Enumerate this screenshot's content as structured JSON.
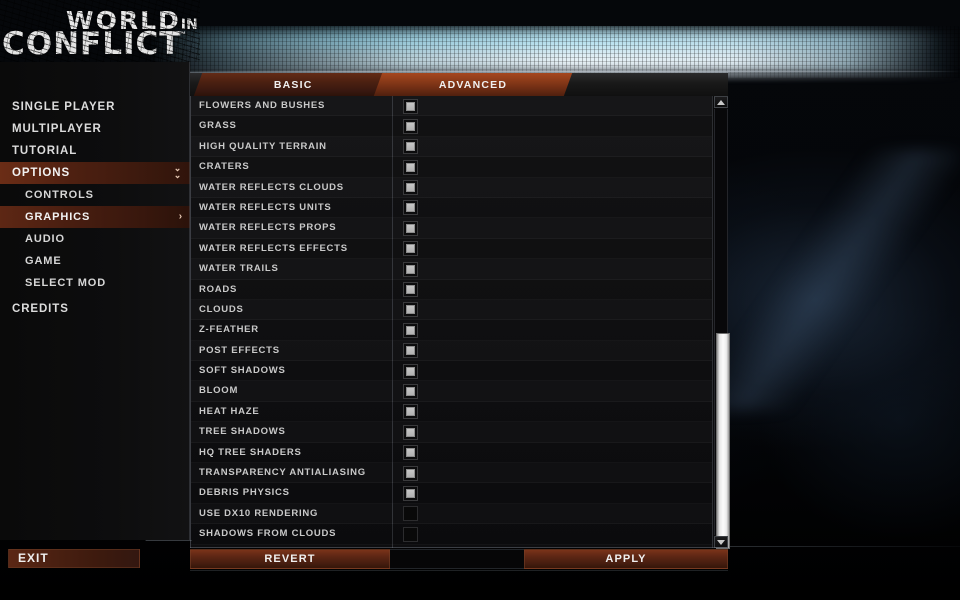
{
  "logo": {
    "line1_main": "WORLD",
    "line1_small": "IN",
    "line2": "CONFLICT",
    "tm": "™"
  },
  "sidebar": {
    "items": [
      {
        "label": "SINGLE PLAYER",
        "level": "top",
        "active": false,
        "chevron": ""
      },
      {
        "label": "MULTIPLAYER",
        "level": "top",
        "active": false,
        "chevron": ""
      },
      {
        "label": "TUTORIAL",
        "level": "top",
        "active": false,
        "chevron": ""
      },
      {
        "label": "OPTIONS",
        "level": "top",
        "active": true,
        "chevron": "double-chevron-down"
      },
      {
        "label": "CONTROLS",
        "level": "sub",
        "active": false,
        "chevron": ""
      },
      {
        "label": "GRAPHICS",
        "level": "sub",
        "active": true,
        "chevron": "chevron-right"
      },
      {
        "label": "AUDIO",
        "level": "sub",
        "active": false,
        "chevron": ""
      },
      {
        "label": "GAME",
        "level": "sub",
        "active": false,
        "chevron": ""
      },
      {
        "label": "SELECT MOD",
        "level": "sub",
        "active": false,
        "chevron": ""
      },
      {
        "label": "CREDITS",
        "level": "top",
        "active": false,
        "chevron": ""
      }
    ],
    "exit_label": "EXIT"
  },
  "tabs": [
    {
      "label": "BASIC",
      "active": false
    },
    {
      "label": "ADVANCED",
      "active": true
    }
  ],
  "settings": {
    "rows": [
      {
        "label": "FLOWERS AND BUSHES",
        "checked": true,
        "enabled": true
      },
      {
        "label": "GRASS",
        "checked": true,
        "enabled": true
      },
      {
        "label": "HIGH QUALITY TERRAIN",
        "checked": true,
        "enabled": true
      },
      {
        "label": "CRATERS",
        "checked": true,
        "enabled": true
      },
      {
        "label": "WATER REFLECTS CLOUDS",
        "checked": true,
        "enabled": true
      },
      {
        "label": "WATER REFLECTS UNITS",
        "checked": true,
        "enabled": true
      },
      {
        "label": "WATER REFLECTS PROPS",
        "checked": true,
        "enabled": true
      },
      {
        "label": "WATER REFLECTS EFFECTS",
        "checked": true,
        "enabled": true
      },
      {
        "label": "WATER TRAILS",
        "checked": true,
        "enabled": true
      },
      {
        "label": "ROADS",
        "checked": true,
        "enabled": true
      },
      {
        "label": "CLOUDS",
        "checked": true,
        "enabled": true
      },
      {
        "label": "Z-FEATHER",
        "checked": true,
        "enabled": true
      },
      {
        "label": "POST EFFECTS",
        "checked": true,
        "enabled": true
      },
      {
        "label": "SOFT SHADOWS",
        "checked": true,
        "enabled": true
      },
      {
        "label": "BLOOM",
        "checked": true,
        "enabled": true
      },
      {
        "label": "HEAT HAZE",
        "checked": true,
        "enabled": true
      },
      {
        "label": "TREE SHADOWS",
        "checked": true,
        "enabled": true
      },
      {
        "label": "HQ TREE SHADERS",
        "checked": true,
        "enabled": true
      },
      {
        "label": "TRANSPARENCY ANTIALIASING",
        "checked": true,
        "enabled": true
      },
      {
        "label": "DEBRIS PHYSICS",
        "checked": true,
        "enabled": true
      },
      {
        "label": "USE DX10 RENDERING",
        "checked": false,
        "enabled": false
      },
      {
        "label": "SHADOWS FROM CLOUDS",
        "checked": false,
        "enabled": false
      }
    ]
  },
  "scrollbar": {
    "up_arrow": "scroll-up-arrow",
    "down_arrow": "scroll-down-arrow"
  },
  "actions": {
    "revert_label": "REVERT",
    "apply_label": "APPLY"
  },
  "colors": {
    "accent_orange": "#a5471f",
    "accent_dark": "#4b2011",
    "text": "#dcdcdc",
    "panel_bg": "#141416",
    "checkbox_fill": "#bcbcbc",
    "glow": "#e8f6ff"
  }
}
